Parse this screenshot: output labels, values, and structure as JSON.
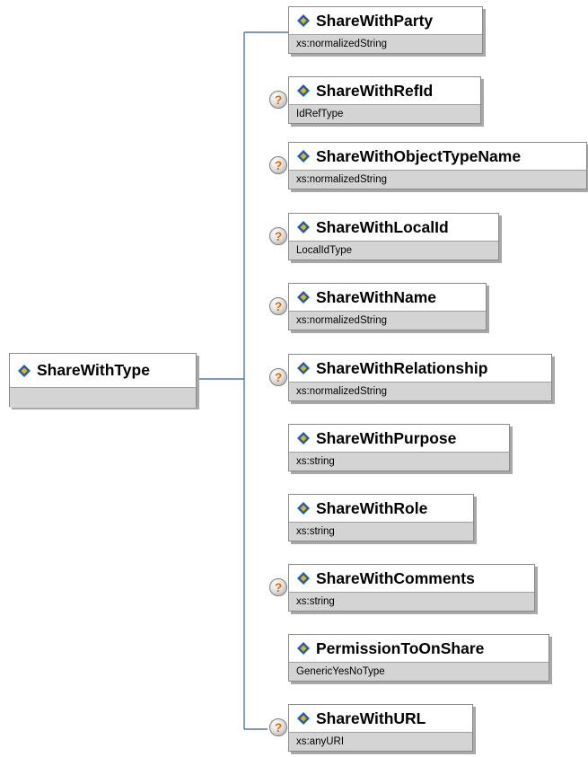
{
  "root": {
    "name": "ShareWithType",
    "icon": "element-diamond-icon"
  },
  "elements": [
    {
      "name": "ShareWithParty",
      "type": "xs:normalizedString",
      "optional": false
    },
    {
      "name": "ShareWithRefId",
      "type": "IdRefType",
      "optional": true
    },
    {
      "name": "ShareWithObjectTypeName",
      "type": "xs:normalizedString",
      "optional": true
    },
    {
      "name": "ShareWithLocalId",
      "type": "LocalIdType",
      "optional": true
    },
    {
      "name": "ShareWithName",
      "type": "xs:normalizedString",
      "optional": true
    },
    {
      "name": "ShareWithRelationship",
      "type": "xs:normalizedString",
      "optional": true
    },
    {
      "name": "ShareWithPurpose",
      "type": "xs:string",
      "optional": false
    },
    {
      "name": "ShareWithRole",
      "type": "xs:string",
      "optional": false
    },
    {
      "name": "ShareWithComments",
      "type": "xs:string",
      "optional": true
    },
    {
      "name": "PermissionToOnShare",
      "type": "GenericYesNoType",
      "optional": false
    },
    {
      "name": "ShareWithURL",
      "type": "xs:anyURI",
      "optional": true
    }
  ],
  "optional_marker": "?",
  "colors": {
    "connector": "#2e5d9a",
    "type_band": "#d4d4d4",
    "border": "#8a8a8a",
    "icon_blue": "#1d5fb8",
    "icon_yellow": "#f0b400",
    "optional_mark": "#e06c00"
  }
}
